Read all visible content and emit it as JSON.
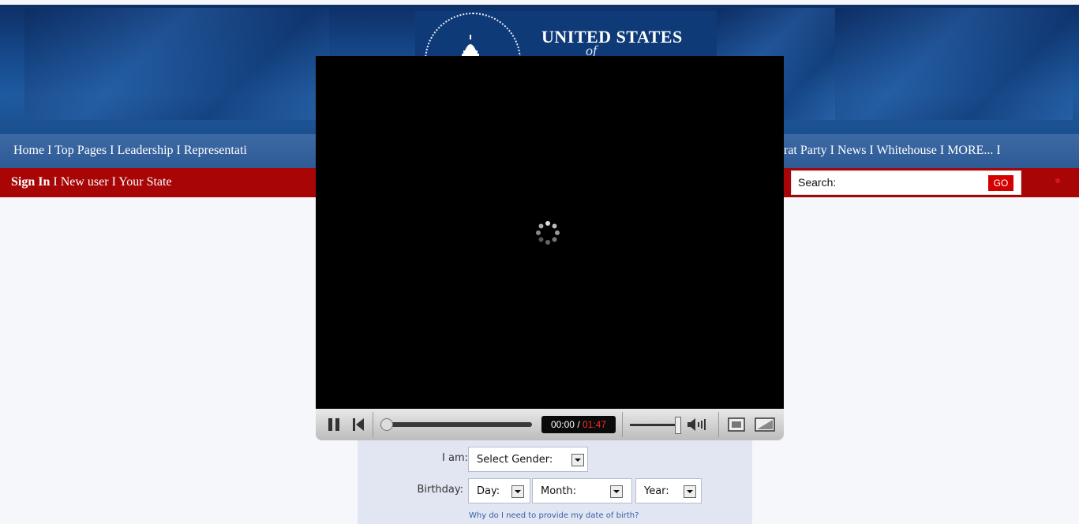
{
  "header": {
    "title": "UNITED STATES",
    "title_of": "of"
  },
  "nav": {
    "left_text": "Home I Top Pages  I Leadership I Representati",
    "right_text": "rat Party I News I Whitehouse I  MORE... I"
  },
  "subnav": {
    "sign_in": "Sign In",
    "separator": " I ",
    "rest": "New user  I Your State"
  },
  "search": {
    "label": "Search:",
    "go_label": "GO"
  },
  "player": {
    "time_current": "00:00",
    "time_separator": " / ",
    "time_total": "01:47",
    "progress": 0,
    "volume": 1.0
  },
  "form": {
    "gender_label": "I am:",
    "gender_value": "Select Gender:",
    "birthday_label": "Birthday:",
    "day_value": "Day:",
    "month_value": "Month:",
    "year_value": "Year:",
    "why_link": "Why do I need to provide my date of birth?"
  },
  "colors": {
    "red_bar": "#a80606",
    "nav_blue": "#2e5a96",
    "time_total": "#ff2a2a"
  }
}
